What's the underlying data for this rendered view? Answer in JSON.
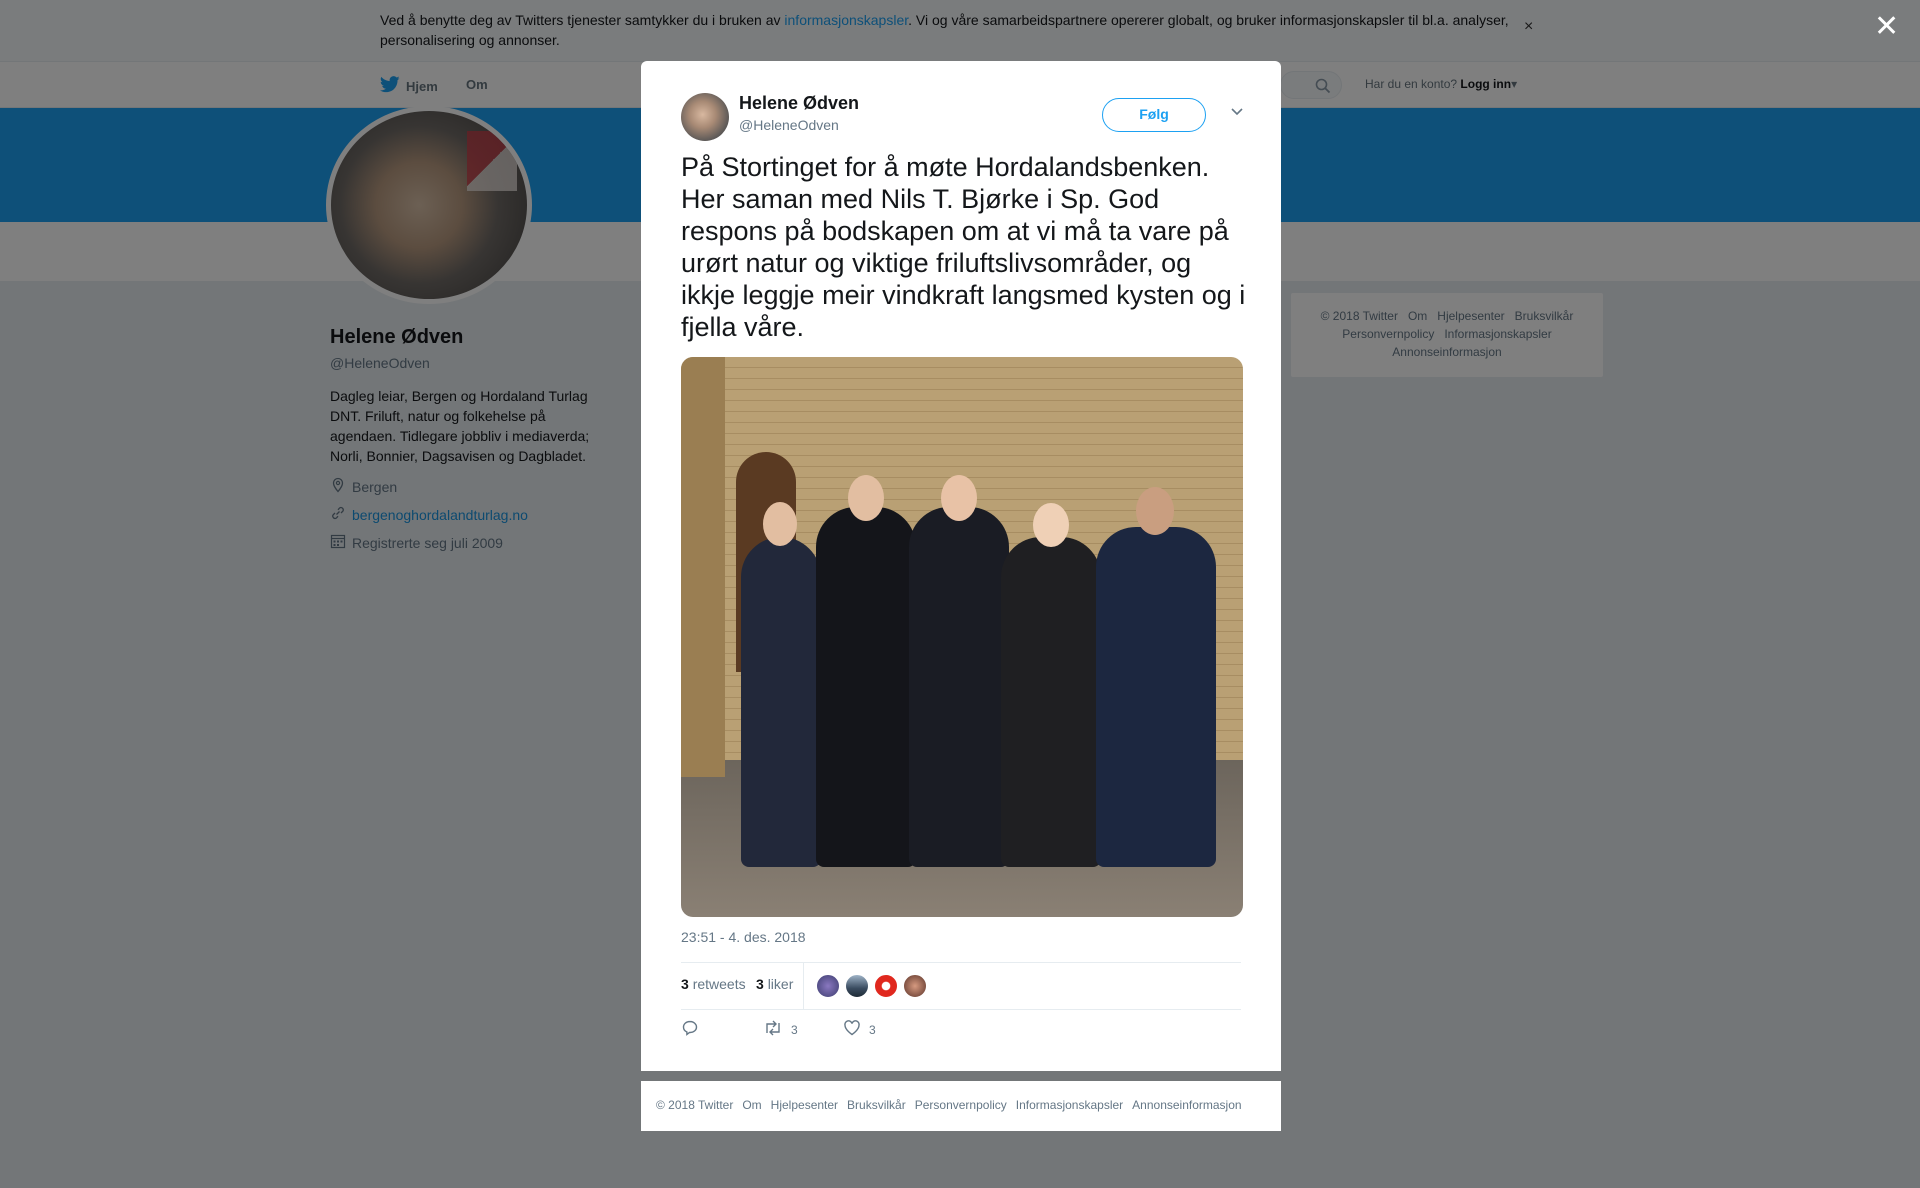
{
  "cookie_banner": {
    "text_before": "Ved å benytte deg av Twitters tjenester samtykker du i bruken av ",
    "link": "informasjonskapsler",
    "text_after": ". Vi og våre samarbeidspartnere opererer globalt, og bruker informasjonskapsler til bl.a. analyser, personalisering og annonser.",
    "close": "×"
  },
  "topnav": {
    "home": "Hjem",
    "about": "Om",
    "login_prompt": "Har du en konto?",
    "login": "Logg inn",
    "login_caret": "▾"
  },
  "profile": {
    "name": "Helene Ødven",
    "handle": "@HeleneOdven",
    "bio": "Dagleg leiar, Bergen og Hordaland Turlag DNT. Friluft, natur og folkehelse på agendaen. Tidlegare jobbliv i mediaverda; Norli, Bonnier, Dagsavisen og Dagbladet.",
    "location": "Bergen",
    "website": "bergenoghordalandturlag.no",
    "joined": "Registrerte seg juli 2009"
  },
  "side_footer": [
    "© 2018 Twitter",
    "Om",
    "Hjelpesenter",
    "Bruksvilkår",
    "Personvernpolicy",
    "Informasjonskapsler",
    "Annonseinformasjon"
  ],
  "overlay_close": "✕",
  "tweet": {
    "author_name": "Helene Ødven",
    "author_handle": "@HeleneOdven",
    "follow_label": "Følg",
    "text": "På Stortinget for å møte Hordalandsbenken. Her saman med Nils T. Bjørke i Sp. God respons på bodskapen om at vi må ta vare på urørt natur og viktige friluftslivsområder, og ikkje leggje meir vindkraft langsmed kysten og i fjella våre.",
    "timestamp": "23:51 - 4. des. 2018",
    "retweets_count": "3",
    "retweets_label": "retweets",
    "likes_count": "3",
    "likes_label": "liker",
    "action_retweet_count": "3",
    "action_like_count": "3"
  },
  "modal_footer": [
    "© 2018 Twitter",
    "Om",
    "Hjelpesenter",
    "Bruksvilkår",
    "Personvernpolicy",
    "Informasjonskapsler",
    "Annonseinformasjon"
  ],
  "colors": {
    "twitter_blue": "#1da1f2",
    "text_secondary": "#657786",
    "overlay": "rgba(0,0,0,0.5)"
  },
  "icons": [
    "twitter-bird-icon",
    "search-icon",
    "location-icon",
    "link-icon",
    "calendar-icon",
    "chevron-down-icon",
    "reply-icon",
    "retweet-icon",
    "heart-icon",
    "close-icon"
  ]
}
